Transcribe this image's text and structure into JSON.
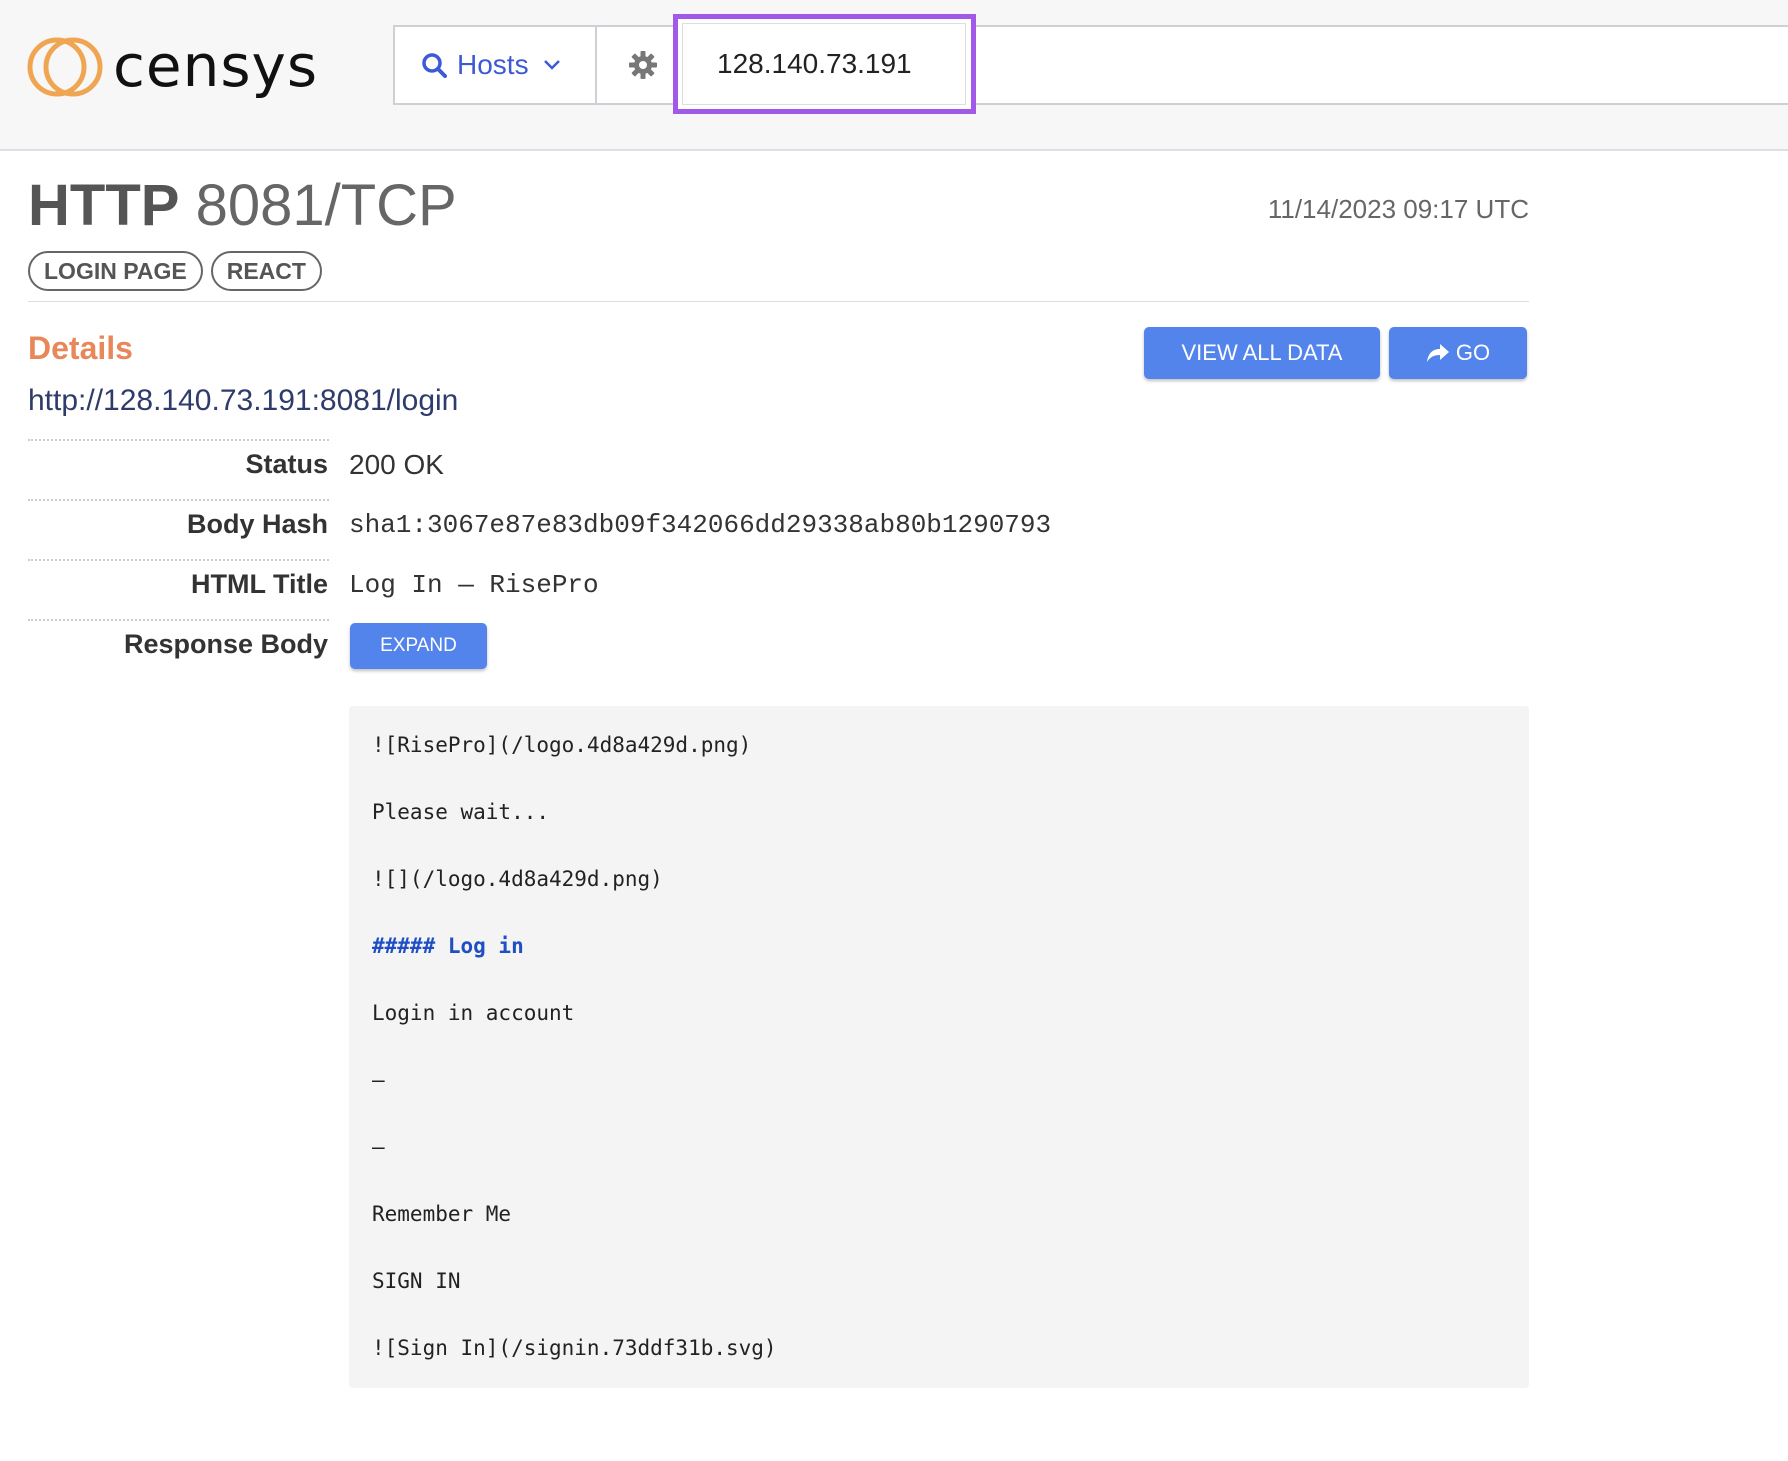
{
  "header": {
    "brand": "censys",
    "search_type": "Hosts",
    "query": "128.140.73.191"
  },
  "service": {
    "protocol": "HTTP",
    "port_proto": "8081/TCP",
    "timestamp": "11/14/2023 09:17 UTC",
    "tags": [
      "LOGIN PAGE",
      "REACT"
    ]
  },
  "details": {
    "heading": "Details",
    "view_all_label": "VIEW ALL DATA",
    "go_label": "GO",
    "url": "http://128.140.73.191:8081/login",
    "fields": [
      {
        "label": "Status",
        "value": "200  OK"
      },
      {
        "label": "Body Hash",
        "value": "sha1:3067e87e83db09f342066dd29338ab80b1290793"
      },
      {
        "label": "HTML Title",
        "value": "Log In — RisePro"
      },
      {
        "label": "Response Body",
        "value": ""
      }
    ],
    "expand_label": "EXPAND"
  },
  "response_body": [
    "![RisePro](/logo.4d8a429d.png)",
    "Please wait...",
    "![](/logo.4d8a429d.png)",
    "##### Log in",
    "Login in account",
    "—",
    "—",
    "Remember Me",
    "SIGN IN",
    "![Sign In](/signin.73ddf31b.svg)"
  ],
  "colors": {
    "accent": "#5384ec",
    "details_heading": "#e8875a",
    "highlight_box": "#a259e8",
    "logo_orange": "#f0a553"
  }
}
